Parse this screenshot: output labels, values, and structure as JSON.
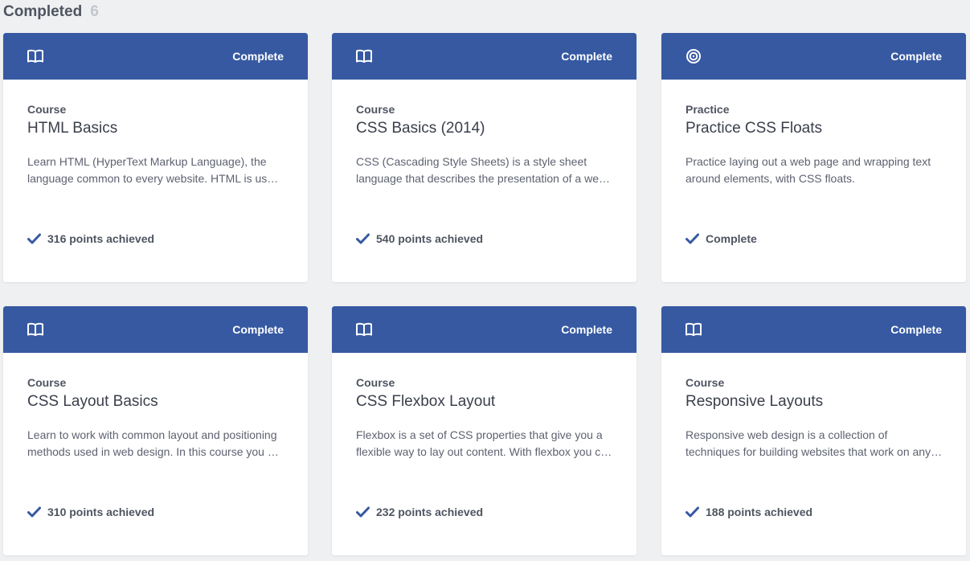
{
  "section": {
    "title": "Completed",
    "count": "6"
  },
  "colors": {
    "header_bg": "#3659a2",
    "check": "#3659a2",
    "page_bg": "#eff0f2"
  },
  "cards": [
    {
      "icon": "book-icon",
      "status": "Complete",
      "type": "Course",
      "title": "HTML Basics",
      "description": "Learn HTML (HyperText Markup Language), the language common to every website. HTML is used to mark up content.",
      "points": "316 points achieved"
    },
    {
      "icon": "book-icon",
      "status": "Complete",
      "type": "Course",
      "title": "CSS Basics (2014)",
      "description": "CSS (Cascading Style Sheets) is a style sheet language that describes the presentation of a web page.",
      "points": "540 points achieved"
    },
    {
      "icon": "target-icon",
      "status": "Complete",
      "type": "Practice",
      "title": "Practice CSS Floats",
      "description": "Practice laying out a web page and wrapping text around elements, with CSS floats.",
      "points": "Complete"
    },
    {
      "icon": "book-icon",
      "status": "Complete",
      "type": "Course",
      "title": "CSS Layout Basics",
      "description": "Learn to work with common layout and positioning methods used in web design. In this course you will learn more.",
      "points": "310 points achieved"
    },
    {
      "icon": "book-icon",
      "status": "Complete",
      "type": "Course",
      "title": "CSS Flexbox Layout",
      "description": "Flexbox is a set of CSS properties that give you a flexible way to lay out content. With flexbox you can build layouts.",
      "points": "232 points achieved"
    },
    {
      "icon": "book-icon",
      "status": "Complete",
      "type": "Course",
      "title": "Responsive Layouts",
      "description": "Responsive web design is a collection of techniques for building websites that work on any device.",
      "points": "188 points achieved"
    }
  ]
}
